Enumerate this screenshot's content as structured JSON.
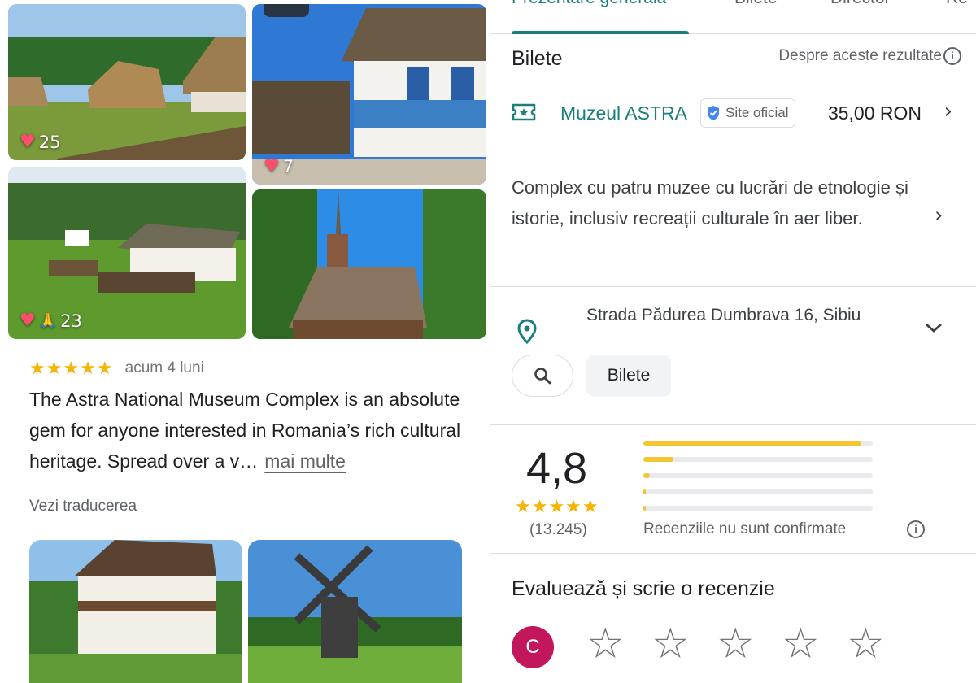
{
  "left": {
    "photos": [
      {
        "likes": "25"
      },
      {
        "likes": "7"
      },
      {
        "likes": "23"
      }
    ],
    "review": {
      "stars": "★★★★★",
      "time": "acum 4 luni",
      "text": "The Astra National Museum Complex is an absolute gem for anyone interested in Romania’s rich cultural heritage. Spread over a v…",
      "more_label": "mai multe",
      "translate_label": "Vezi traducerea"
    }
  },
  "right": {
    "tabs": [
      "Prezentare generală",
      "Bilete",
      "Director",
      "Re"
    ],
    "tickets": {
      "heading": "Bilete",
      "about_label": "Despre aceste rezultate",
      "provider": "Muzeul ASTRA",
      "official_label": "Site oficial",
      "price": "35,00 RON"
    },
    "description": "Complex cu patru muzee cu lucrări de etnologie și istorie, inclusiv recreații culturale în aer liber.",
    "address": "Strada Pădurea Dumbrava 16, Sibiu",
    "chips": {
      "tickets_label": "Bilete"
    },
    "rating": {
      "value": "4,8",
      "stars": "★★★★★",
      "count": "(13.245)",
      "distribution": [
        0.95,
        0.13,
        0.03,
        0.01,
        0.01
      ],
      "unconfirmed_label": "Recenziile nu sunt confirmate"
    },
    "write_review": {
      "heading": "Evaluează și scrie o recenzie",
      "avatar_letter": "C"
    }
  },
  "colors": {
    "accent": "#1a7f7a",
    "star": "#f4b400",
    "avatar": "#c2185b",
    "heart": "#ff4d6d"
  },
  "icons": [
    "heart-icon",
    "ticket-icon",
    "verified-shield-icon",
    "info-icon",
    "chevron-right-icon",
    "location-pin-icon",
    "chevron-down-icon",
    "search-icon",
    "star-outline-icon"
  ]
}
